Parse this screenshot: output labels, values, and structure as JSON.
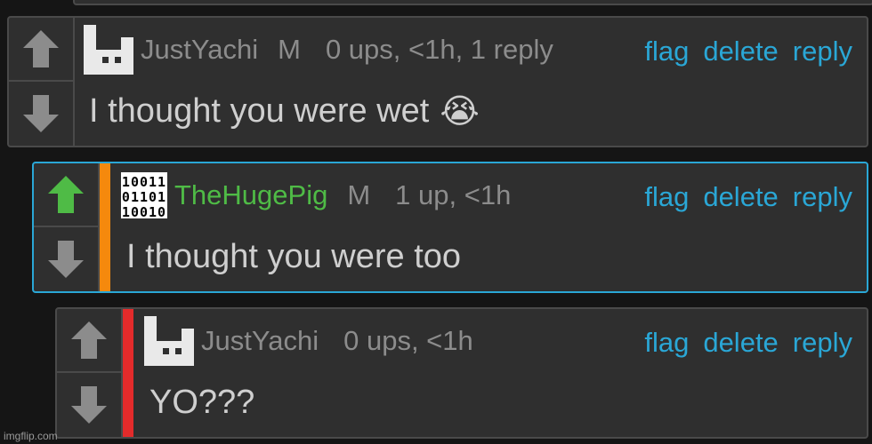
{
  "comments": [
    {
      "username": "JustYachi",
      "mod_badge": "M",
      "meta": "0 ups, <1h, 1 reply",
      "text": "I thought you were wet",
      "emoji": "😭",
      "upvoted": false,
      "stripe_color": null
    },
    {
      "username": "TheHugePig",
      "mod_badge": "M",
      "meta": "1 up, <1h",
      "text": "I thought you were too",
      "emoji": null,
      "upvoted": true,
      "stripe_color": "#f5890d",
      "avatar_lines": [
        "10011",
        "01101",
        "10010"
      ]
    },
    {
      "username": "JustYachi",
      "mod_badge": null,
      "meta": "0 ups, <1h",
      "text": "YO???",
      "emoji": null,
      "upvoted": false,
      "stripe_color": "#e32b2b"
    }
  ],
  "actions": {
    "flag": "flag",
    "delete": "delete",
    "reply": "reply"
  },
  "colors": {
    "link": "#2aa7d6",
    "upvote_active": "#4fbb46",
    "vote_idle": "#8c8c8c",
    "selected_border": "#2aa7d6"
  },
  "watermark": "imgflip.com"
}
